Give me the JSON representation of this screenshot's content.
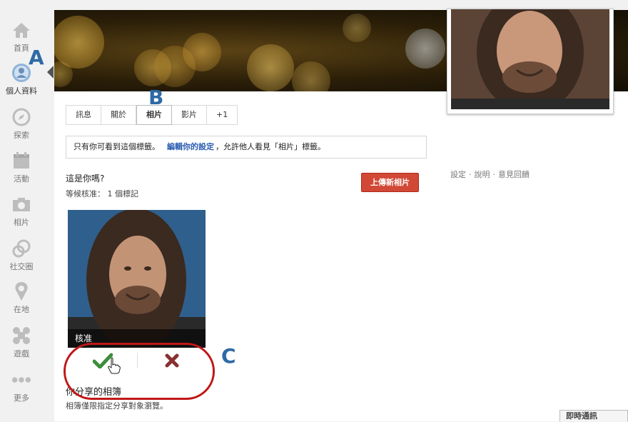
{
  "nav": {
    "items": [
      {
        "label": "首頁",
        "icon": "home-icon"
      },
      {
        "label": "個人資料",
        "icon": "profile-icon"
      },
      {
        "label": "探索",
        "icon": "compass-icon"
      },
      {
        "label": "活動",
        "icon": "calendar-icon"
      },
      {
        "label": "相片",
        "icon": "camera-icon"
      },
      {
        "label": "社交圈",
        "icon": "circles-icon"
      },
      {
        "label": "在地",
        "icon": "location-pin-icon"
      },
      {
        "label": "遊戲",
        "icon": "games-icon"
      },
      {
        "label": "更多",
        "icon": "more-dots-icon"
      }
    ]
  },
  "tabs": [
    {
      "label": "訊息"
    },
    {
      "label": "關於"
    },
    {
      "label": "相片"
    },
    {
      "label": "影片"
    },
    {
      "label": "+1"
    }
  ],
  "notice": {
    "prefix": "只有你可看到這個標籤。",
    "link": "編輯你的設定",
    "suffix": "，允許他人看見「相片」標籤。"
  },
  "tag_review": {
    "question": "這是你嗎?",
    "pending": "等候核准： 1 個標記",
    "upload_label": "上傳新相片",
    "overlay_label": "核准"
  },
  "shared_albums": {
    "title": "你分享的相簿",
    "description": "相簿僅限指定分享對象瀏覽。"
  },
  "footer_links": [
    "設定",
    "說明",
    "意見回饋"
  ],
  "chat": {
    "label": "即時通訊"
  },
  "annotations": {
    "a": "A",
    "b": "B",
    "c": "C"
  },
  "colors": {
    "upload_button": "#d14836",
    "approve_check": "#3b8e3b",
    "reject_x": "#8a3030",
    "annotation_letter": "#2e6aa5",
    "annotation_circle": "#c01818"
  }
}
